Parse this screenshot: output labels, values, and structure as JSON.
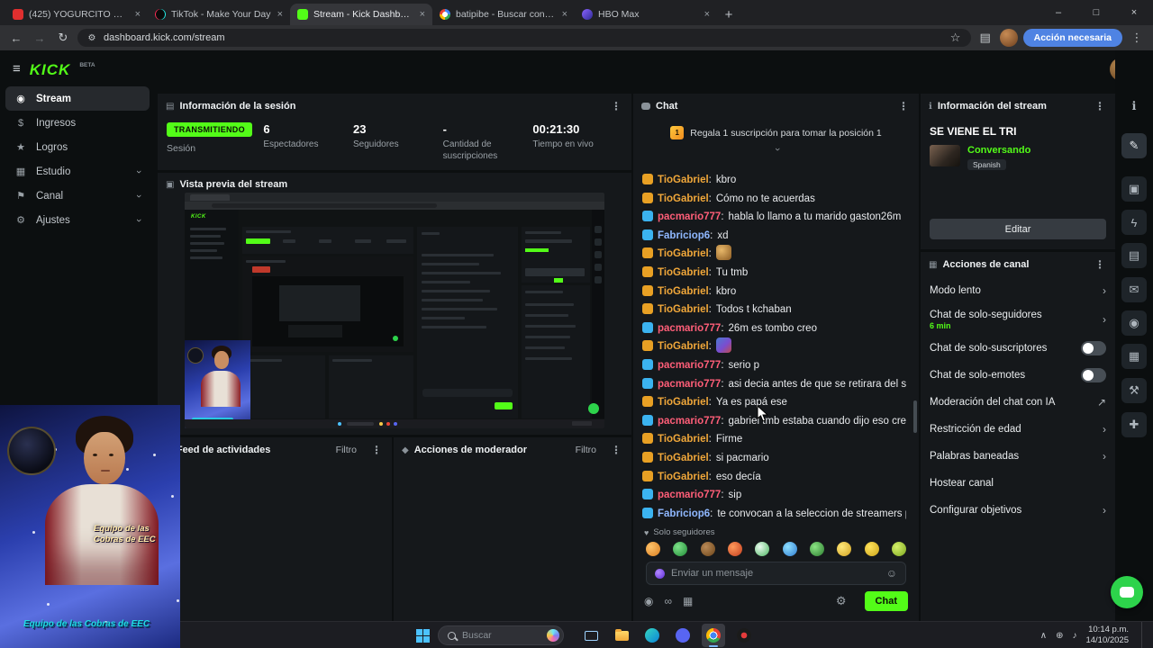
{
  "accent": "#53fc18",
  "browser": {
    "tabs": [
      {
        "label": "(425) YOGURCITO REMI...",
        "active": false
      },
      {
        "label": "TikTok - Make Your Day",
        "active": false
      },
      {
        "label": "Stream - Kick Dashboard",
        "active": true
      },
      {
        "label": "batipibe - Buscar con Google",
        "active": false
      },
      {
        "label": "HBO Max",
        "active": false
      }
    ],
    "url": "dashboard.kick.com/stream",
    "action_needed_label": "Acción necesaria"
  },
  "sidebar": {
    "logo": "KICK",
    "beta": "BETA",
    "items": [
      {
        "label": "Stream"
      },
      {
        "label": "Ingresos"
      },
      {
        "label": "Logros"
      },
      {
        "label": "Estudio"
      },
      {
        "label": "Canal"
      },
      {
        "label": "Ajustes"
      }
    ]
  },
  "session": {
    "title": "Información de la sesión",
    "live_badge": "TRANSMITIENDO",
    "live_sub": "Sesión",
    "stats": [
      {
        "value": "6",
        "label": "Espectadores"
      },
      {
        "value": "23",
        "label": "Seguidores"
      },
      {
        "value": "-",
        "label": "Cantidad de suscripciones"
      },
      {
        "value": "00:21:30",
        "label": "Tiempo en vivo"
      }
    ]
  },
  "preview": {
    "title": "Vista previa del stream",
    "nested_logo": "KICK"
  },
  "feed": {
    "title": "Feed de actividades",
    "filter_label": "Filtro"
  },
  "mod": {
    "title": "Acciones de moderador",
    "filter_label": "Filtro"
  },
  "chat": {
    "title": "Chat",
    "pinned_rank": "1",
    "pinned": "Regala 1 suscripción para tomar la posición 1",
    "colon": ":",
    "followers_only_label": "Solo seguidores",
    "input_placeholder": "Enviar un mensaje",
    "send_label": "Chat",
    "messages": [
      {
        "user": "TioGabriel",
        "color": "#f0a73a",
        "badge": "#e8a024",
        "text": "kbro"
      },
      {
        "user": "TioGabriel",
        "color": "#f0a73a",
        "badge": "#e8a024",
        "text": "Cómo no te acuerdas"
      },
      {
        "user": "pacmario777",
        "color": "#ff5e78",
        "badge": "#3bb3f0",
        "text": "habla lo llamo a tu marido gaston26m"
      },
      {
        "user": "Fabriciop6",
        "color": "#8fb8ff",
        "badge": "#3bb3f0",
        "text": "xd"
      },
      {
        "user": "TioGabriel",
        "color": "#f0a73a",
        "badge": "#e8a024",
        "text": "",
        "emote": true
      },
      {
        "user": "TioGabriel",
        "color": "#f0a73a",
        "badge": "#e8a024",
        "text": "Tu tmb"
      },
      {
        "user": "TioGabriel",
        "color": "#f0a73a",
        "badge": "#e8a024",
        "text": "kbro"
      },
      {
        "user": "TioGabriel",
        "color": "#f0a73a",
        "badge": "#e8a024",
        "text": "Todos t kchaban"
      },
      {
        "user": "pacmario777",
        "color": "#ff5e78",
        "badge": "#3bb3f0",
        "text": "26m es tombo creo"
      },
      {
        "user": "TioGabriel",
        "color": "#f0a73a",
        "badge": "#e8a024",
        "text": "",
        "emote": true
      },
      {
        "user": "pacmario777",
        "color": "#ff5e78",
        "badge": "#3bb3f0",
        "text": "serio p"
      },
      {
        "user": "pacmario777",
        "color": "#ff5e78",
        "badge": "#3bb3f0",
        "text": "asi decia antes de que se retirara del stream"
      },
      {
        "user": "TioGabriel",
        "color": "#f0a73a",
        "badge": "#e8a024",
        "text": "Ya es papá ese"
      },
      {
        "user": "pacmario777",
        "color": "#ff5e78",
        "badge": "#3bb3f0",
        "text": "gabriel tmb estaba cuando dijo eso creo"
      },
      {
        "user": "TioGabriel",
        "color": "#f0a73a",
        "badge": "#e8a024",
        "text": "Firme"
      },
      {
        "user": "TioGabriel",
        "color": "#f0a73a",
        "badge": "#e8a024",
        "text": "si pacmario"
      },
      {
        "user": "TioGabriel",
        "color": "#f0a73a",
        "badge": "#e8a024",
        "text": "eso decía"
      },
      {
        "user": "pacmario777",
        "color": "#ff5e78",
        "badge": "#3bb3f0",
        "text": "sip"
      },
      {
        "user": "Fabriciop6",
        "color": "#8fb8ff",
        "badge": "#3bb3f0",
        "text": "te convocan a la seleccion de streamers pa?"
      }
    ]
  },
  "stream_info": {
    "title": "Información del stream",
    "stream_title": "SE VIENE EL TRI",
    "category": "Conversando",
    "language": "Spanish",
    "edit_label": "Editar"
  },
  "channel_actions": {
    "title": "Acciones de canal",
    "items": [
      {
        "label": "Modo lento"
      },
      {
        "label": "Chat de solo-seguidores",
        "sub": "6 min"
      },
      {
        "label": "Chat de solo-suscriptores"
      },
      {
        "label": "Chat de solo-emotes"
      },
      {
        "label": "Moderación del chat con IA"
      },
      {
        "label": "Restricción de edad"
      },
      {
        "label": "Palabras baneadas"
      },
      {
        "label": "Hostear canal"
      },
      {
        "label": "Configurar objetivos"
      }
    ]
  },
  "webcam": {
    "caption_line1": "Equipo de las",
    "caption_line2": "Cobras de EEC",
    "footer_line1": "Equipo de las",
    "footer_line2": "Cobras de EEC"
  },
  "taskbar": {
    "search_placeholder": "Buscar",
    "time": "10:14 p.m.",
    "date": "14/10/2025"
  }
}
